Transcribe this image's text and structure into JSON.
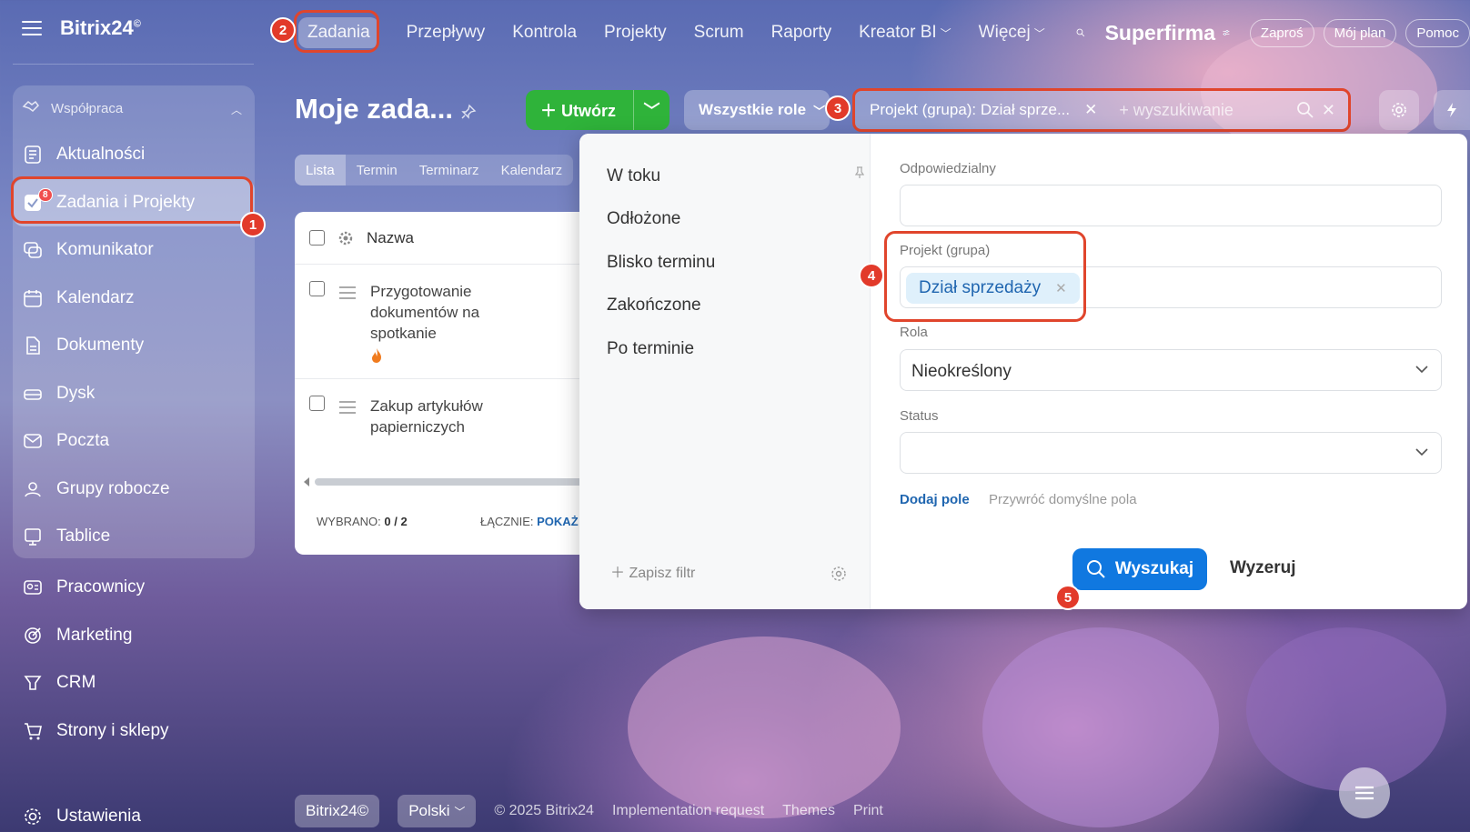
{
  "brand": {
    "name": "Bitrix24",
    "mark": "©"
  },
  "sidebar": {
    "section_label": "Współpraca",
    "items": [
      {
        "label": "Aktualności",
        "icon": "newspaper-icon"
      },
      {
        "label": "Zadania i Projekty",
        "icon": "task-check-icon",
        "badge": "8",
        "active": true
      },
      {
        "label": "Komunikator",
        "icon": "chat-icon"
      },
      {
        "label": "Kalendarz",
        "icon": "calendar-icon"
      },
      {
        "label": "Dokumenty",
        "icon": "document-icon"
      },
      {
        "label": "Dysk",
        "icon": "drive-icon"
      },
      {
        "label": "Poczta",
        "icon": "mail-icon"
      },
      {
        "label": "Grupy robocze",
        "icon": "group-icon"
      },
      {
        "label": "Tablice",
        "icon": "board-icon"
      }
    ],
    "bottom_items": [
      {
        "label": "Pracownicy",
        "icon": "employees-icon"
      },
      {
        "label": "Marketing",
        "icon": "target-icon"
      },
      {
        "label": "CRM",
        "icon": "crm-icon"
      },
      {
        "label": "Strony i sklepy",
        "icon": "cart-icon"
      },
      {
        "label": "Ustawienia",
        "icon": "gear-icon"
      }
    ]
  },
  "topnav": {
    "items": [
      "Zadania",
      "Przepływy",
      "Kontrola",
      "Projekty",
      "Scrum",
      "Raporty",
      "Kreator BI",
      "Więcej"
    ],
    "company": "Superfirma",
    "invite": "Zaproś",
    "plan": "Mój plan",
    "help": "Pomoc"
  },
  "page": {
    "title": "Moje zada...",
    "create_label": "Utwórz",
    "roles_label": "Wszystkie role",
    "filter_chip": "Projekt (grupa): Dział sprze...",
    "search_placeholder": "+ wyszukiwanie"
  },
  "view_tabs": [
    "Lista",
    "Termin",
    "Terminarz",
    "Kalendarz"
  ],
  "grid": {
    "column_name": "Nazwa",
    "rows": [
      {
        "title": "Przygotowanie dokumentów na spotkanie",
        "hot": true
      },
      {
        "title": "Zakup artykułów papierniczych",
        "hot": false
      }
    ],
    "selected_label": "WYBRANO:",
    "selected_value": "0 / 2",
    "total_label": "ŁĄCZNIE:",
    "total_link": "POKAŻ"
  },
  "filter_popup": {
    "presets": [
      "W toku",
      "Odłożone",
      "Blisko terminu",
      "Zakończone",
      "Po terminie"
    ],
    "save_filter": "Zapisz filtr",
    "fields": {
      "responsible_label": "Odpowiedzialny",
      "project_label": "Projekt (grupa)",
      "project_value": "Dział sprzedaży",
      "role_label": "Rola",
      "role_value": "Nieokreślony",
      "status_label": "Status"
    },
    "add_field": "Dodaj pole",
    "restore_fields": "Przywróć domyślne pola",
    "search_button": "Wyszukaj",
    "reset_button": "Wyzeruj"
  },
  "footer": {
    "brand": "Bitrix24©",
    "language": "Polski",
    "copyright": "© 2025 Bitrix24",
    "impl": "Implementation request",
    "themes": "Themes",
    "print": "Print"
  },
  "callouts": [
    "1",
    "2",
    "3",
    "4",
    "5"
  ],
  "colors": {
    "accent_green": "#2fb33a",
    "accent_blue": "#1078e0",
    "highlight_red": "#e0452c",
    "badge_red": "#f04d4d"
  }
}
